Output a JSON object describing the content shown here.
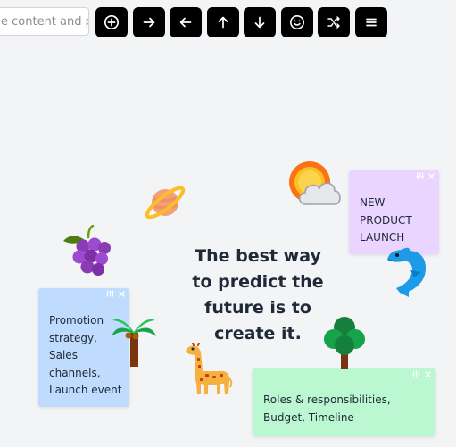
{
  "toolbar": {
    "search_placeholder": "e content and pr",
    "buttons": [
      {
        "icon": "plus-circle-icon"
      },
      {
        "icon": "arrow-right-icon"
      },
      {
        "icon": "arrow-left-icon"
      },
      {
        "icon": "arrow-up-icon"
      },
      {
        "icon": "arrow-down-icon"
      },
      {
        "icon": "smiley-icon"
      },
      {
        "icon": "shuffle-icon"
      },
      {
        "icon": "menu-icon"
      }
    ]
  },
  "notes": {
    "product": {
      "text": "NEW\nPRODUCT\nLAUNCH",
      "color": "#e9d5ff"
    },
    "promo": {
      "text": "Promotion\nstrategy,\nSales\nchannels,\nLaunch event",
      "color": "#bfdbfe"
    },
    "roles": {
      "text": "Roles & responsibilities,\nBudget, Timeline",
      "color": "#bbf7d0"
    }
  },
  "quote": "The best way to predict the future is to create it.",
  "stickers": [
    "sun-behind-cloud-icon",
    "ringed-planet-icon",
    "grapes-icon",
    "dolphin-icon",
    "palm-tree-icon",
    "deciduous-tree-icon",
    "giraffe-icon"
  ],
  "colors": {
    "canvas": "#f3f4f6",
    "toolbar_button": "#000000",
    "note_purple": "#e9d5ff",
    "note_blue": "#bfdbfe",
    "note_green": "#bbf7d0"
  }
}
